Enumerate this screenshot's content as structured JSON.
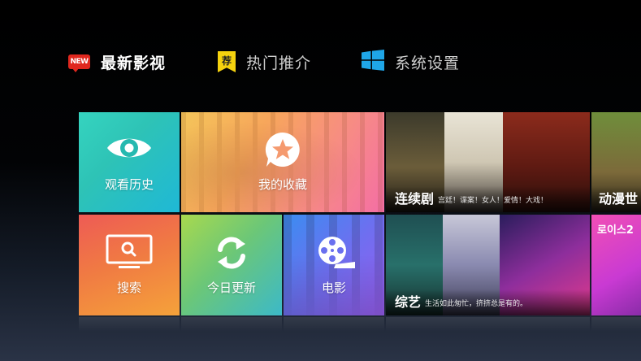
{
  "nav": {
    "items": [
      {
        "label": "最新影视",
        "icon": "new-badge-icon",
        "icon_text": "NEW",
        "active": true
      },
      {
        "label": "热门推介",
        "icon": "recommend-bookmark-icon",
        "icon_text": "荐",
        "active": false
      },
      {
        "label": "系统设置",
        "icon": "windows-logo-icon",
        "active": false
      }
    ]
  },
  "tiles": {
    "history": {
      "label": "观看历史",
      "icon": "eye-icon"
    },
    "favorites": {
      "label": "我的收藏",
      "icon": "star-bubble-icon"
    },
    "search": {
      "label": "搜索",
      "icon": "tv-search-icon"
    },
    "today_update": {
      "label": "今日更新",
      "icon": "refresh-icon"
    },
    "movies": {
      "label": "电影",
      "icon": "film-reel-icon"
    }
  },
  "posters": {
    "series": {
      "title": "连续剧",
      "subtitle": "宫廷！谍案！女人！爱情！大戏！"
    },
    "variety": {
      "title": "综艺",
      "subtitle": "生活如此匆忙，挤挤总是有的。"
    },
    "anime": {
      "title": "动漫世"
    },
    "anime2": {
      "title": "로이스2"
    }
  },
  "colors": {
    "history": "#2ec3b6",
    "favorites": "#f78a86",
    "search": "#f07a43",
    "today_update": "#6cc777",
    "movies": "#6e6ff0",
    "nav_new_badge": "#e0271e",
    "nav_recommend_badge": "#f5d20e",
    "nav_windows_logo": "#1fa6e8"
  }
}
